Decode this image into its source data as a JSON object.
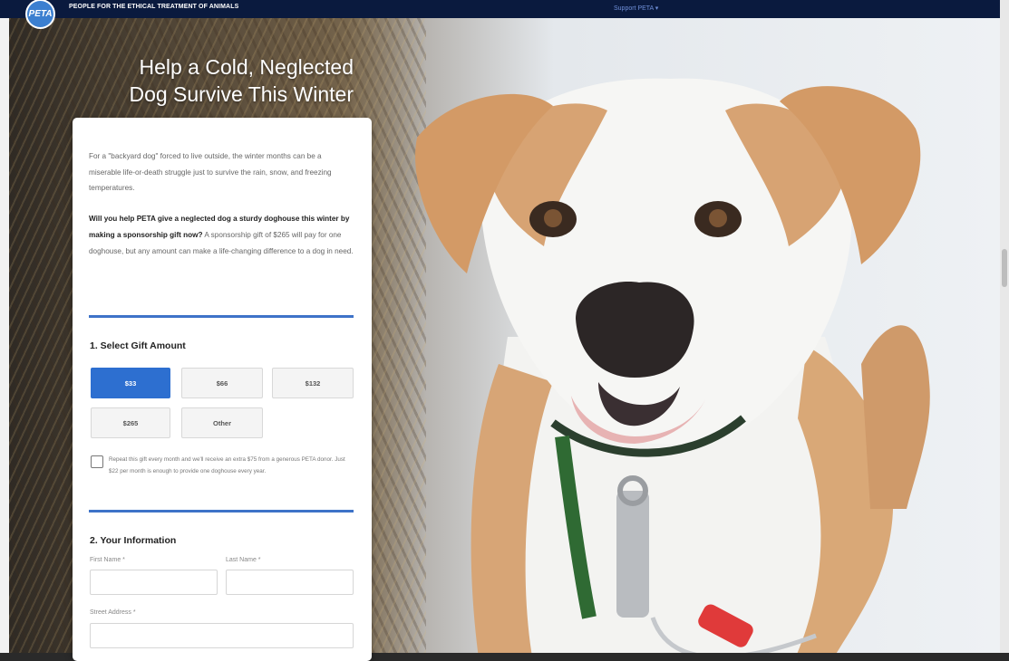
{
  "header": {
    "logo": "PETA",
    "org": "PEOPLE FOR THE ETHICAL TREATMENT OF ANIMALS",
    "support": "Support PETA ▾"
  },
  "hero": {
    "headline_line1": "Help a Cold, Neglected",
    "headline_line2": "Dog Survive This Winter"
  },
  "form": {
    "intro": "For a \"backyard dog\" forced to live outside, the winter months can be a miserable life-or-death struggle just to survive the rain, snow, and freezing temperatures.",
    "appeal_bold": "Will you help PETA give a neglected dog a sturdy doghouse this winter by making a sponsorship gift now?",
    "appeal_rest": " A sponsorship gift of $265 will pay for one doghouse, but any amount can make a life-changing difference to a dog in need.",
    "section1_title": "1. Select Gift Amount",
    "amounts": [
      "$33",
      "$66",
      "$132",
      "$265",
      "Other"
    ],
    "selected_amount": "$33",
    "repeat_text": "Repeat this gift every month and we'll receive an extra $75 from a generous PETA donor. Just $22 per month is enough to provide one doghouse every year.",
    "section2_title": "2. Your Information",
    "first_name_label": "First Name *",
    "last_name_label": "Last Name *",
    "street_label": "Street Address *"
  },
  "colors": {
    "nav_bg": "#0a1a3e",
    "accent": "#2d6fd0",
    "rule": "#3e73c8"
  }
}
